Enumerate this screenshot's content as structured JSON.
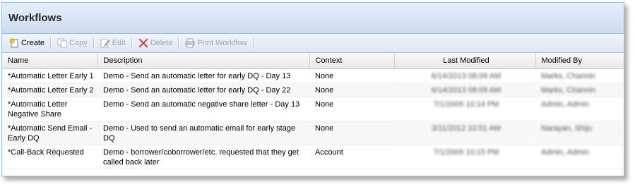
{
  "panel": {
    "title": "Workflows"
  },
  "toolbar": {
    "create": "Create",
    "copy": "Copy",
    "edit": "Edit",
    "delete": "Delete",
    "print": "Print Workflow"
  },
  "columns": {
    "name": "Name",
    "description": "Description",
    "context": "Context",
    "last_modified": "Last Modified",
    "modified_by": "Modified By"
  },
  "rows": [
    {
      "name": "*Automatic Letter Early 1",
      "description": "Demo - Send an automatic letter for early DQ - Day 13",
      "context": "None",
      "last_modified": "6/14/2013 08:09 AM",
      "modified_by": "Marks, Channin"
    },
    {
      "name": "*Automatic Letter Early 2",
      "description": "Demo - Send an automatic letter for early DQ - Day 22",
      "context": "None",
      "last_modified": "6/14/2013 08:09 AM",
      "modified_by": "Marks, Channin"
    },
    {
      "name": "*Automatic Letter Negative Share",
      "description": "Demo - Send an automatic negative share letter - Day 13",
      "context": "None",
      "last_modified": "7/1/2009 10:14 PM",
      "modified_by": "Admin, Admin"
    },
    {
      "name": "*Automatic Send Email - Early DQ",
      "description": "Demo - Used to send an automatic email for early stage DQ",
      "context": "None",
      "last_modified": "3/11/2012 10:51 AM",
      "modified_by": "Narayan, Shiju"
    },
    {
      "name": "*Call-Back Requested",
      "description": "Demo - borrower/coborrower/etc. requested that they get called back later",
      "context": "Account",
      "last_modified": "7/1/2009 10:15 PM",
      "modified_by": "Admin, Admin"
    }
  ]
}
